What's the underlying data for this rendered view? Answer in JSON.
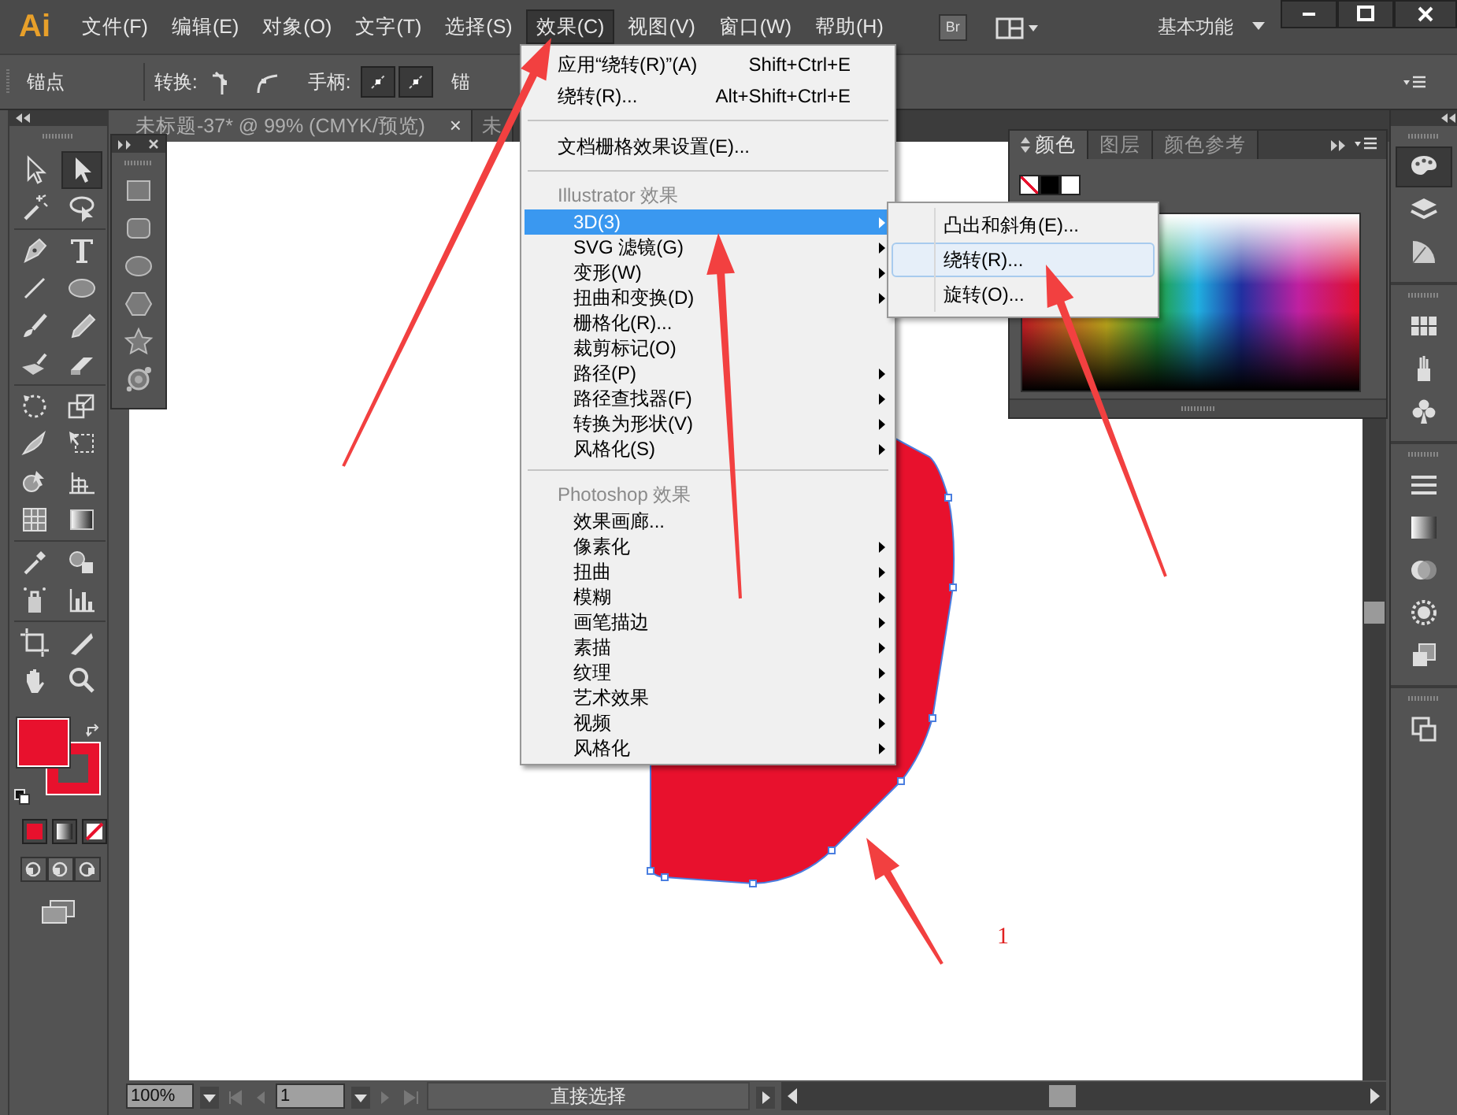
{
  "app_logo": "Ai",
  "menu_bar": [
    {
      "label": "文件(F)",
      "selected": false
    },
    {
      "label": "编辑(E)",
      "selected": false
    },
    {
      "label": "对象(O)",
      "selected": false
    },
    {
      "label": "文字(T)",
      "selected": false
    },
    {
      "label": "选择(S)",
      "selected": false
    },
    {
      "label": "效果(C)",
      "selected": true
    },
    {
      "label": "视图(V)",
      "selected": false
    },
    {
      "label": "窗口(W)",
      "selected": false
    },
    {
      "label": "帮助(H)",
      "selected": false
    }
  ],
  "bridge_button": "Br",
  "workspace": "基本功能",
  "control_bar": {
    "title": "锚点",
    "convert_label": "转换:",
    "handles_label": "手柄:",
    "anchor_label": "锚"
  },
  "document_tabs": [
    {
      "title": "未标题-37* @ 99% (CMYK/预览)",
      "selected": true,
      "close": "×"
    },
    {
      "title": "未",
      "selected": false
    }
  ],
  "tools": [
    {
      "selected": false
    },
    {
      "selected": true
    },
    {
      "selected": false
    },
    {
      "selected": false
    },
    {
      "selected": false
    },
    {
      "selected": false
    },
    {
      "selected": false
    },
    {
      "selected": false
    },
    {
      "selected": false
    },
    {
      "selected": false
    },
    {
      "selected": false
    },
    {
      "selected": false
    },
    {
      "selected": false
    },
    {
      "selected": false
    },
    {
      "selected": false
    },
    {
      "selected": false
    },
    {
      "selected": false
    },
    {
      "selected": false
    },
    {
      "selected": false
    },
    {
      "selected": false
    },
    {
      "selected": false
    },
    {
      "selected": false
    },
    {
      "selected": false
    },
    {
      "selected": false
    },
    {
      "selected": false
    },
    {
      "selected": false
    },
    {
      "selected": false
    },
    {
      "selected": false
    }
  ],
  "effect_menu": [
    {
      "kind": "command",
      "label": "应用“绕转(R)”(A)",
      "shortcut": "Shift+Ctrl+E",
      "selected": false
    },
    {
      "kind": "command",
      "label": "绕转(R)...",
      "shortcut": "Alt+Shift+Ctrl+E",
      "selected": false
    },
    {
      "kind": "separator"
    },
    {
      "kind": "command",
      "label": "文档栅格效果设置(E)...",
      "selected": false
    },
    {
      "kind": "separator"
    },
    {
      "kind": "header",
      "label": "Illustrator 效果"
    },
    {
      "kind": "entry",
      "label": "3D(3)",
      "submenu": true,
      "selected": true
    },
    {
      "kind": "entry",
      "label": "SVG 滤镜(G)",
      "submenu": true,
      "selected": false
    },
    {
      "kind": "entry",
      "label": "变形(W)",
      "submenu": true,
      "selected": false
    },
    {
      "kind": "entry",
      "label": "扭曲和变换(D)",
      "submenu": true,
      "selected": false
    },
    {
      "kind": "entry",
      "label": "栅格化(R)...",
      "submenu": false,
      "selected": false
    },
    {
      "kind": "entry",
      "label": "裁剪标记(O)",
      "submenu": false,
      "selected": false
    },
    {
      "kind": "entry",
      "label": "路径(P)",
      "submenu": true,
      "selected": false
    },
    {
      "kind": "entry",
      "label": "路径查找器(F)",
      "submenu": true,
      "selected": false
    },
    {
      "kind": "entry",
      "label": "转换为形状(V)",
      "submenu": true,
      "selected": false
    },
    {
      "kind": "entry",
      "label": "风格化(S)",
      "submenu": true,
      "selected": false
    },
    {
      "kind": "separator"
    },
    {
      "kind": "header",
      "label": "Photoshop 效果"
    },
    {
      "kind": "entry",
      "label": "效果画廊...",
      "submenu": false,
      "selected": false
    },
    {
      "kind": "entry",
      "label": "像素化",
      "submenu": true,
      "selected": false
    },
    {
      "kind": "entry",
      "label": "扭曲",
      "submenu": true,
      "selected": false
    },
    {
      "kind": "entry",
      "label": "模糊",
      "submenu": true,
      "selected": false
    },
    {
      "kind": "entry",
      "label": "画笔描边",
      "submenu": true,
      "selected": false
    },
    {
      "kind": "entry",
      "label": "素描",
      "submenu": true,
      "selected": false
    },
    {
      "kind": "entry",
      "label": "纹理",
      "submenu": true,
      "selected": false
    },
    {
      "kind": "entry",
      "label": "艺术效果",
      "submenu": true,
      "selected": false
    },
    {
      "kind": "entry",
      "label": "视频",
      "submenu": true,
      "selected": false
    },
    {
      "kind": "entry",
      "label": "风格化",
      "submenu": true,
      "selected": false
    }
  ],
  "submenu_3d": [
    {
      "label": "凸出和斜角(E)...",
      "selected": false
    },
    {
      "label": "绕转(R)...",
      "selected": true
    },
    {
      "label": "旋转(O)...",
      "selected": false
    }
  ],
  "color_panel": {
    "tabs": [
      {
        "label": "颜色",
        "selected": true
      },
      {
        "label": "图层",
        "selected": false
      },
      {
        "label": "颜色参考",
        "selected": false
      }
    ]
  },
  "canvas": {
    "note": "1"
  },
  "status_bar": {
    "zoom": "100%",
    "artboard": "1",
    "tool": "直接选择"
  }
}
